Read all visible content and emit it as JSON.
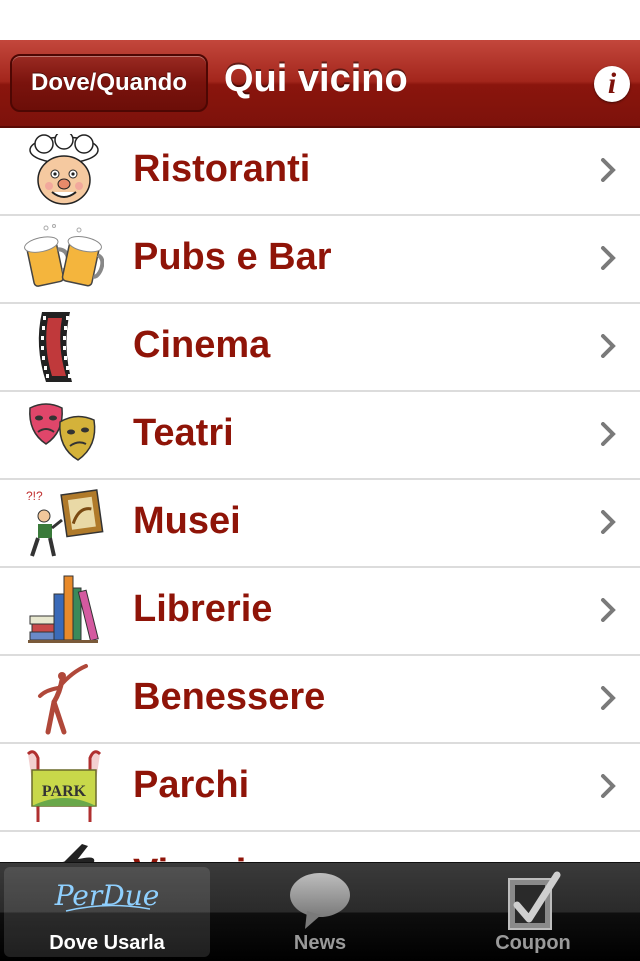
{
  "navbar": {
    "back_label": "Dove/Quando",
    "title": "Qui vicino",
    "info_glyph": "i"
  },
  "list": {
    "items": [
      {
        "label": "Ristoranti",
        "icon": "chef-icon"
      },
      {
        "label": "Pubs e Bar",
        "icon": "beer-mugs-icon"
      },
      {
        "label": "Cinema",
        "icon": "film-strip-icon"
      },
      {
        "label": "Teatri",
        "icon": "theater-masks-icon"
      },
      {
        "label": "Musei",
        "icon": "museum-painting-icon"
      },
      {
        "label": "Librerie",
        "icon": "books-icon"
      },
      {
        "label": "Benessere",
        "icon": "dancer-icon"
      },
      {
        "label": "Parchi",
        "icon": "park-sign-icon"
      },
      {
        "label": "Viaggi",
        "icon": "airplane-icon"
      }
    ]
  },
  "tabbar": {
    "tabs": [
      {
        "label": "Dove Usarla",
        "logo_text": "PerDue",
        "active": true
      },
      {
        "label": "News",
        "active": false
      },
      {
        "label": "Coupon",
        "active": false
      }
    ]
  },
  "colors": {
    "navbar_red": "#a3261c",
    "label_red": "#8f1408"
  }
}
